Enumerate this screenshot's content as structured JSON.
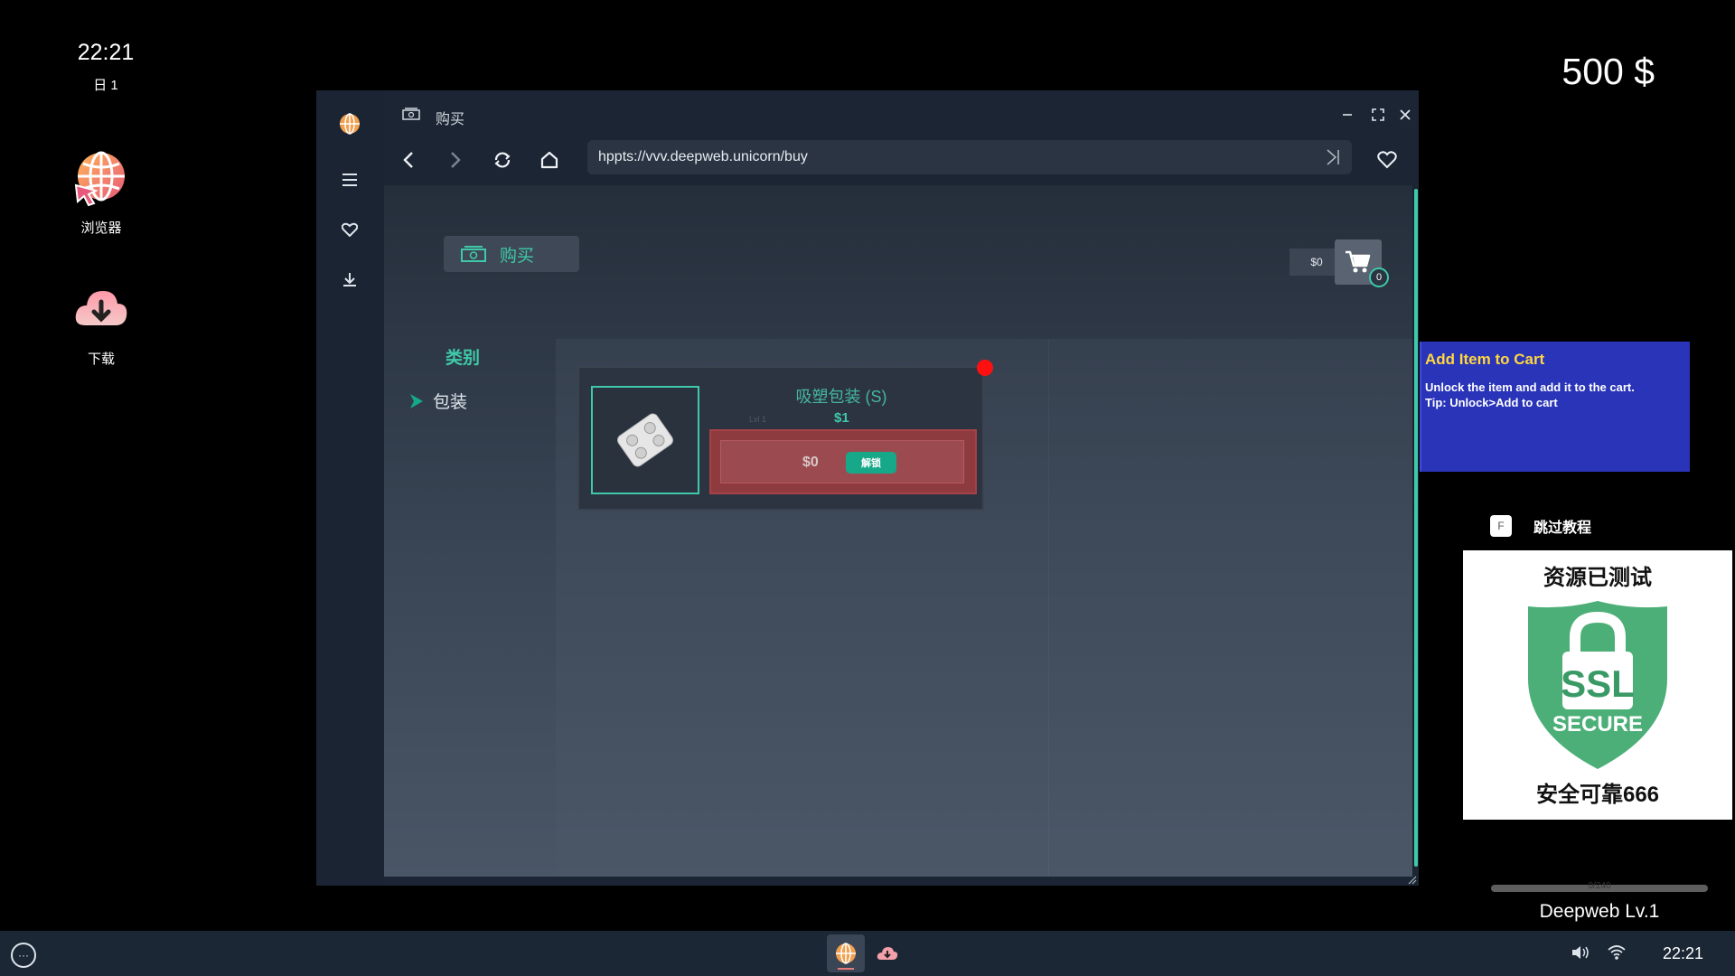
{
  "desktop": {
    "clock": {
      "time": "22:21",
      "day": "日 1"
    },
    "money": "500 $",
    "icons": [
      {
        "name": "browser",
        "label": "浏览器",
        "icon": "globe-cursor-icon"
      },
      {
        "name": "download",
        "label": "下载",
        "icon": "cloud-download-icon"
      }
    ]
  },
  "browser": {
    "tab_title": "购买",
    "url": "hppts://vvv.deepweb.unicorn/buy",
    "sidebar": [
      "globe-icon",
      "menu-icon",
      "heart-icon",
      "download-icon"
    ],
    "page": {
      "buy_tab_label": "购买",
      "cart_total": "$0",
      "cart_count": "0",
      "category_title": "类别",
      "categories": [
        {
          "label": "包装"
        }
      ],
      "products": [
        {
          "name": "吸塑包装 (S)",
          "level": "Lvl 1",
          "price": "$1",
          "unlock_cost": "$0",
          "unlock_label": "解锁"
        }
      ]
    }
  },
  "tutorial": {
    "title": "Add Item to Cart",
    "body_line1": "Unlock the item and add it to the cart.",
    "body_line2": "Tip: Unlock>Add to cart"
  },
  "skip": {
    "key": "F",
    "label": "跳过教程"
  },
  "ssl_badge": {
    "top_text": "资源已测试",
    "ssl": "SSL",
    "secure": "SECURE",
    "bottom_text": "安全可靠666"
  },
  "level": {
    "progress_text": "0/240",
    "progress_fraction": 0.0,
    "label": "Deepweb Lv.1"
  },
  "taskbar": {
    "time": "22:21",
    "menu_glyph": "···"
  },
  "colors": {
    "accent": "#3fc9a8",
    "unlock_red": "#8e3b3f",
    "tutorial_blue": "#2a34b8",
    "ssl_green": "#4caf78"
  }
}
